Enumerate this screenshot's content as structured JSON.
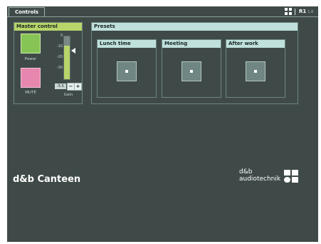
{
  "tabs": [
    {
      "label": "Controls"
    }
  ],
  "status": {
    "room_label": "R1",
    "room_sub": "1.8"
  },
  "master": {
    "title": "Master control",
    "power_label": "Power",
    "mute_label": "MUTE",
    "gain_label": "Gain",
    "gain_value": "-5.5",
    "gain_level_fraction": 0.78,
    "scale": [
      "0",
      "-10",
      "-20",
      "-30"
    ],
    "minus_label": "−",
    "plus_label": "+"
  },
  "presets": {
    "title": "Presets",
    "items": [
      {
        "label": "Lunch time"
      },
      {
        "label": "Meeting"
      },
      {
        "label": "After work"
      }
    ]
  },
  "app_title": "d&b Canteen",
  "brand": {
    "line1": "d&b",
    "line2": "audiotechnik"
  },
  "colors": {
    "background": "#3f4a48",
    "master_accent": "#b8d46a",
    "presets_accent": "#bfe0dd",
    "power": "#86c455",
    "mute": "#e786ae"
  }
}
